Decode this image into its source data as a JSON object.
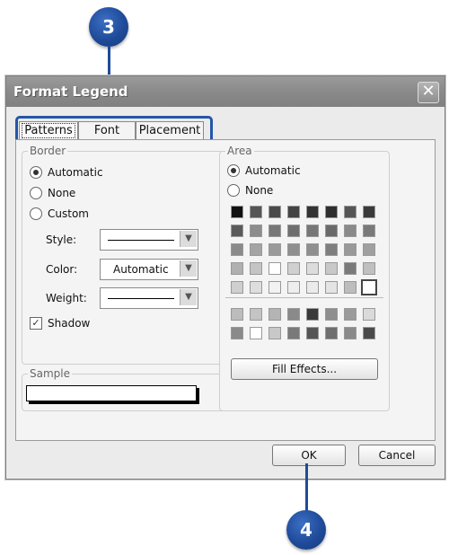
{
  "callouts": {
    "top": "3",
    "bottom": "4"
  },
  "dialog": {
    "title": "Format Legend",
    "close_symbol": "✕"
  },
  "tabs": [
    {
      "label": "Patterns",
      "active": true
    },
    {
      "label": "Font",
      "active": false
    },
    {
      "label": "Placement",
      "active": false
    }
  ],
  "border": {
    "label": "Border",
    "options": [
      {
        "label": "Automatic",
        "checked": true
      },
      {
        "label": "None",
        "checked": false
      },
      {
        "label": "Custom",
        "checked": false
      }
    ],
    "style_label": "Style:",
    "color_label": "Color:",
    "color_value": "Automatic",
    "weight_label": "Weight:",
    "shadow_label": "Shadow",
    "shadow_checked": true
  },
  "sample": {
    "label": "Sample"
  },
  "area": {
    "label": "Area",
    "options": [
      {
        "label": "Automatic",
        "checked": true
      },
      {
        "label": "None",
        "checked": false
      }
    ],
    "palette_rows": [
      [
        "#111111",
        "#555555",
        "#4a4a4a",
        "#444444",
        "#333333",
        "#2e2e2e",
        "#555555",
        "#3a3a3a"
      ],
      [
        "#5a5a5a",
        "#8c8c8c",
        "#777777",
        "#6e6e6e",
        "#777777",
        "#6a6a6a",
        "#8a8a8a",
        "#7a7a7a"
      ],
      [
        "#8a8a8a",
        "#a4a4a4",
        "#9a9a9a",
        "#8f8f8f",
        "#8f8f8f",
        "#7e7e7e",
        "#999999",
        "#a0a0a0"
      ],
      [
        "#b0b0b0",
        "#c4c4c4",
        "#ffffff",
        "#d0d0d0",
        "#dcdcdc",
        "#c8c8c8",
        "#7a7a7a",
        "#c0c0c0"
      ],
      [
        "#cfcfcf",
        "#dedede",
        "#f2f2f2",
        "#eeeeee",
        "#ebebeb",
        "#e4e4e4",
        "#bdbdbd",
        "#ffffff"
      ]
    ],
    "extra_rows": [
      [
        "#bcbcbc",
        "#c4c4c4",
        "#b4b4b4",
        "#8a8a8a",
        "#3a3a3a",
        "#8e8e8e",
        "#9a9a9a",
        "#dadada"
      ],
      [
        "#8a8a8a",
        "#ffffff",
        "#c8c8c8",
        "#7a7a7a",
        "#555555",
        "#6e6e6e",
        "#8a8a8a",
        "#4a4a4a"
      ]
    ],
    "fill_effects_label": "Fill Effects..."
  },
  "buttons": {
    "ok": "OK",
    "cancel": "Cancel"
  }
}
